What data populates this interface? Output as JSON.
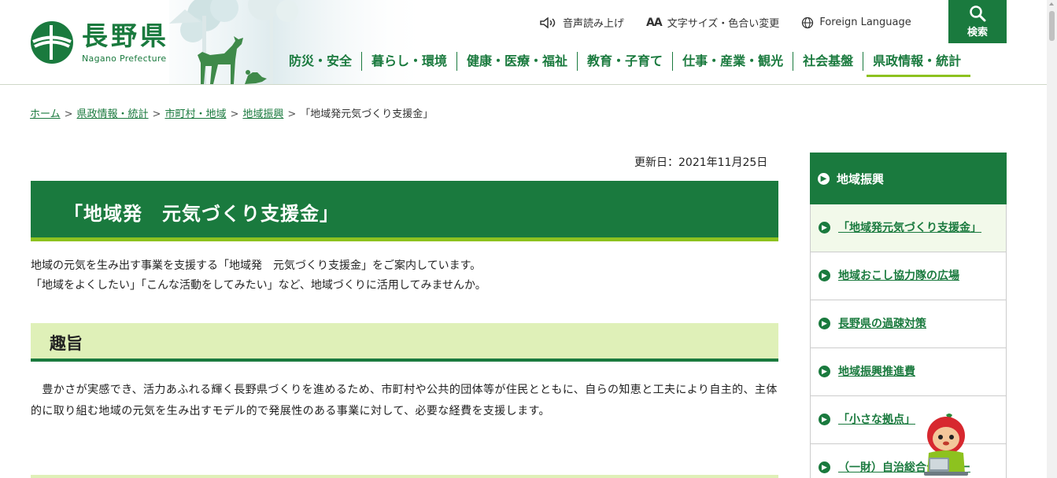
{
  "header": {
    "logo_jp": "長野県",
    "logo_en": "Nagano Prefecture",
    "utility": {
      "read_aloud": "音声読み上げ",
      "text_size_icon": "AA",
      "text_size": "文字サイズ・色合い変更",
      "foreign": "Foreign Language"
    },
    "search_label": "検索"
  },
  "gnav": [
    {
      "label": "防災・安全"
    },
    {
      "label": "暮らし・環境"
    },
    {
      "label": "健康・医療・福祉"
    },
    {
      "label": "教育・子育て"
    },
    {
      "label": "仕事・産業・観光"
    },
    {
      "label": "社会基盤"
    },
    {
      "label": "県政情報・統計"
    }
  ],
  "breadcrumb": {
    "items": [
      "ホーム",
      "県政情報・統計",
      "市町村・地域",
      "地域振興"
    ],
    "separator": ">",
    "current": "「地域発元気づくり支援金」"
  },
  "updated": "更新日：2021年11月25日",
  "main": {
    "title": "「地域発　元気づくり支援金」",
    "intro_line1": "地域の元気を生み出す事業を支援する「地域発　元気づくり支援金」をご案内しています。",
    "intro_line2": "「地域をよくしたい」「こんな活動をしてみたい」など、地域づくりに活用してみませんか。",
    "section_heading": "趣旨",
    "section_body": "　豊かさが実感でき、活力あふれる輝く長野県づくりを進めるため、市町村や公共的団体等が住民とともに、自らの知恵と工夫により自主的、主体的に取り組む地域の元気を生み出すモデル的で発展性のある事業に対して、必要な経費を支援します。"
  },
  "sidebar": {
    "heading": "地域振興",
    "items": [
      {
        "label": "「地域発元気づくり支援金」"
      },
      {
        "label": "地域おこし協力隊の広場"
      },
      {
        "label": "長野県の過疎対策"
      },
      {
        "label": "地域振興推進費"
      },
      {
        "label": "「小さな拠点」"
      },
      {
        "label": "（一財）自治総合センター"
      }
    ]
  },
  "colors": {
    "brand_green": "#1a7a3e",
    "accent_lime": "#8dc21f",
    "pale_green": "#dff0b8"
  }
}
